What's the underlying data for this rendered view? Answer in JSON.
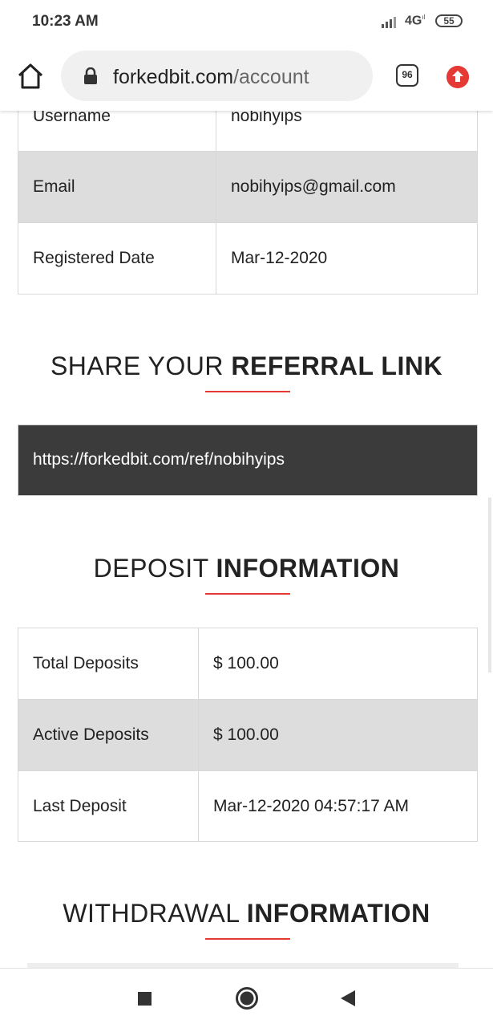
{
  "status": {
    "time": "10:23 AM",
    "network": "4G",
    "battery": "55"
  },
  "browser": {
    "url_domain": "forkedbit.com",
    "url_path": "/account",
    "tab_count": "96"
  },
  "account_table": [
    {
      "label": "Username",
      "value": "nobihyips"
    },
    {
      "label": "Email",
      "value": "nobihyips@gmail.com"
    },
    {
      "label": "Registered Date",
      "value": "Mar-12-2020"
    }
  ],
  "referral": {
    "heading_light": "SHARE YOUR",
    "heading_bold": "REFERRAL LINK",
    "link": "https://forkedbit.com/ref/nobihyips"
  },
  "deposit": {
    "heading_light": "DEPOSIT",
    "heading_bold": "INFORMATION",
    "rows": [
      {
        "label": "Total Deposits",
        "value": "$ 100.00"
      },
      {
        "label": "Active Deposits",
        "value": "$ 100.00"
      },
      {
        "label": "Last Deposit",
        "value": "Mar-12-2020 04:57:17 AM"
      }
    ]
  },
  "withdrawal": {
    "heading_light": "WITHDRAWAL",
    "heading_bold": "INFORMATION"
  },
  "colors": {
    "accent": "#e53935",
    "shade": "#dddddd",
    "ref_bg": "#3b3b3b"
  },
  "icons": [
    "home-icon",
    "lock-icon",
    "tab-switcher-icon",
    "update-icon",
    "recent-apps-icon",
    "nav-home-icon",
    "back-icon"
  ]
}
